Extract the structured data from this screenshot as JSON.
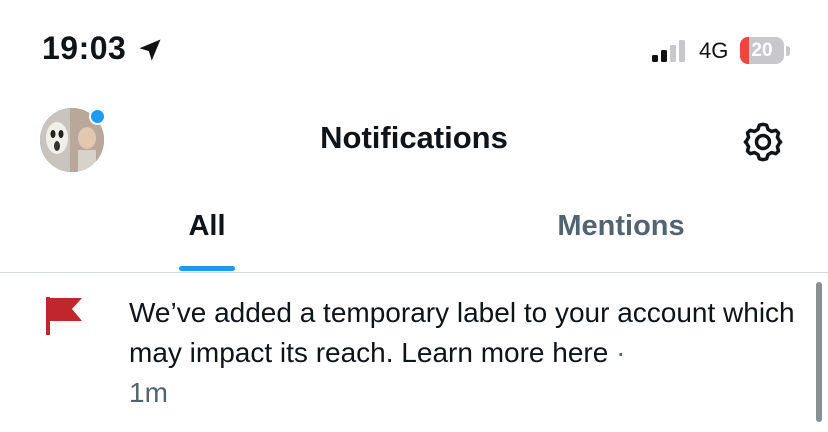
{
  "status_bar": {
    "time": "19:03",
    "network": "4G",
    "battery_level": "20",
    "battery_fraction": 0.2,
    "icons": [
      "location-arrow-icon",
      "signal-bars-icon",
      "battery-icon"
    ]
  },
  "header": {
    "title": "Notifications",
    "avatar_icon": "avatar",
    "settings_icon": "gear-icon"
  },
  "tabs": [
    {
      "label": "All",
      "selected": true
    },
    {
      "label": "Mentions",
      "selected": false
    }
  ],
  "notification": {
    "icon": "flag-icon",
    "text": "We’ve added a temporary label to your account which may impact its reach. Learn more here",
    "separator": "·",
    "time": "1m"
  },
  "colors": {
    "accent": "#1d9bf0",
    "flag": "#c0272d",
    "battery_low": "#ef4444",
    "secondary_text": "#536471"
  }
}
